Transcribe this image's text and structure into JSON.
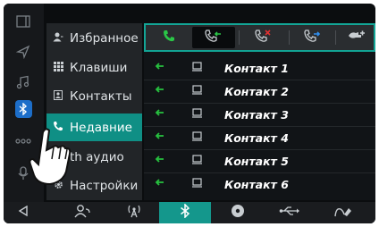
{
  "rail": {
    "items": [
      {
        "name": "panel-icon",
        "glyph": "▯"
      },
      {
        "name": "navigation-icon",
        "glyph": "➢"
      },
      {
        "name": "music-icon",
        "glyph": "♫"
      },
      {
        "name": "bluetooth-icon",
        "glyph": "✱"
      },
      {
        "name": "more-icon",
        "glyph": "∘∘∘"
      },
      {
        "name": "microphone-icon",
        "glyph": "⚲"
      },
      {
        "name": "back-icon",
        "glyph": "◁"
      }
    ]
  },
  "menu": {
    "items": [
      {
        "label": "Избранное",
        "icon": "👤"
      },
      {
        "label": "Клавиши",
        "icon": "▦"
      },
      {
        "label": "Контакты",
        "icon": "▣"
      },
      {
        "label": "Недавние",
        "icon": "☏"
      },
      {
        "label": "th аудио",
        "icon": "♪"
      },
      {
        "label": "Настройки",
        "icon": "⚙"
      }
    ]
  },
  "tabs": [
    "all-calls-icon",
    "incoming-calls-icon",
    "missed-calls-icon",
    "outgoing-calls-icon",
    "forwarded-calls-icon"
  ],
  "contacts": [
    {
      "name": "Контакт 1"
    },
    {
      "name": "Контакт 2"
    },
    {
      "name": "Контакт 3"
    },
    {
      "name": "Контакт 4"
    },
    {
      "name": "Контакт 5"
    },
    {
      "name": "Контакт 6"
    }
  ],
  "bottombar": [
    "person-call-icon",
    "antenna-icon",
    "bluetooth-icon",
    "disc-icon",
    "usb-icon",
    "aux-icon"
  ]
}
